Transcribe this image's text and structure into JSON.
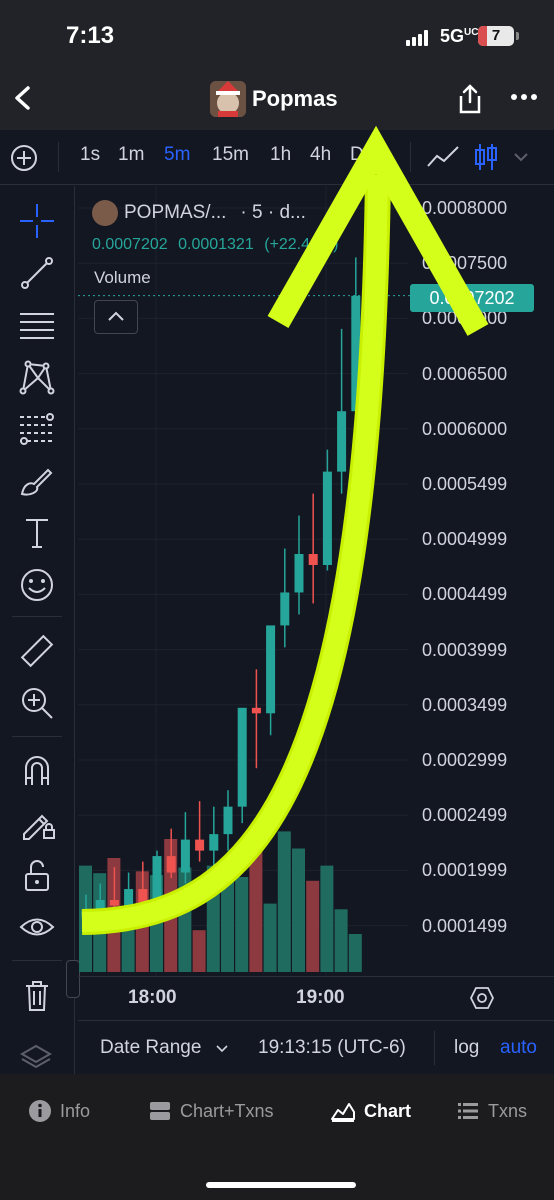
{
  "status_bar": {
    "time": "7:13",
    "network": "5G",
    "network_sup": "UC",
    "battery": "7"
  },
  "nav": {
    "title": "Popmas"
  },
  "toolbar": {
    "intervals": [
      {
        "label": "1s",
        "active": false
      },
      {
        "label": "1m",
        "active": false
      },
      {
        "label": "5m",
        "active": true
      },
      {
        "label": "15m",
        "active": false
      },
      {
        "label": "1h",
        "active": false
      },
      {
        "label": "4h",
        "active": false
      },
      {
        "label": "D",
        "active": false
      }
    ]
  },
  "left_tools": [
    "crosshair-icon",
    "trend-line-icon",
    "horizontal-lines-icon",
    "pattern-icon",
    "fib-icon",
    "brush-icon",
    "text-icon",
    "emoji-icon",
    "ruler-icon",
    "zoom-in-icon",
    "magnet-icon",
    "lock-drawing-icon",
    "unlock-icon",
    "eye-icon",
    "trash-icon",
    "layers-icon"
  ],
  "legend": {
    "symbol": "POPMAS/...",
    "interval": "· 5 · d...",
    "price": "0.0007202",
    "change": "0.0001321",
    "change_pct": "(+22.46%)",
    "volume_label": "Volume"
  },
  "price_axis": [
    "0.0008000",
    "0.0007500",
    "0.0007000",
    "0.0006500",
    "0.0006000",
    "0.0005499",
    "0.0004999",
    "0.0004499",
    "0.0003999",
    "0.0003499",
    "0.0002999",
    "0.0002499",
    "0.0001999",
    "0.0001499"
  ],
  "last_price": "0.0007202",
  "time_axis": [
    "18:00",
    "19:00"
  ],
  "bottom_bar": {
    "date_range": "Date Range",
    "clock": "19:13:15 (UTC-6)",
    "log": "log",
    "auto": "auto"
  },
  "tabs": [
    {
      "label": "Info",
      "active": false
    },
    {
      "label": "Chart+Txns",
      "active": false
    },
    {
      "label": "Chart",
      "active": true
    },
    {
      "label": "Txns",
      "active": false
    }
  ],
  "colors": {
    "up": "#26a69a",
    "down": "#ef5350",
    "accent": "#2962ff",
    "arrow": "#d4ff1a"
  },
  "chart_data": {
    "type": "candlestick",
    "interval": "5m",
    "price_axis_range": [
      0.00012,
      0.00081
    ],
    "candles": [
      {
        "o": 0.000155,
        "h": 0.000175,
        "l": 0.000142,
        "c": 0.00016
      },
      {
        "o": 0.00016,
        "h": 0.000185,
        "l": 0.00015,
        "c": 0.00017
      },
      {
        "o": 0.00017,
        "h": 0.0002,
        "l": 0.000155,
        "c": 0.000165
      },
      {
        "o": 0.000165,
        "h": 0.000195,
        "l": 0.00015,
        "c": 0.00018
      },
      {
        "o": 0.00018,
        "h": 0.000205,
        "l": 0.00017,
        "c": 0.000168
      },
      {
        "o": 0.000168,
        "h": 0.000215,
        "l": 0.00016,
        "c": 0.00021
      },
      {
        "o": 0.00021,
        "h": 0.000235,
        "l": 0.00019,
        "c": 0.000195
      },
      {
        "o": 0.000195,
        "h": 0.00025,
        "l": 0.000185,
        "c": 0.000225
      },
      {
        "o": 0.000225,
        "h": 0.00026,
        "l": 0.000205,
        "c": 0.000215
      },
      {
        "o": 0.000215,
        "h": 0.000255,
        "l": 0.0002,
        "c": 0.00023
      },
      {
        "o": 0.00023,
        "h": 0.00027,
        "l": 0.000215,
        "c": 0.000255
      },
      {
        "o": 0.000255,
        "h": 0.00032,
        "l": 0.00024,
        "c": 0.000345
      },
      {
        "o": 0.000345,
        "h": 0.00038,
        "l": 0.00029,
        "c": 0.00034
      },
      {
        "o": 0.00034,
        "h": 0.00041,
        "l": 0.00032,
        "c": 0.00042
      },
      {
        "o": 0.00042,
        "h": 0.00049,
        "l": 0.0004,
        "c": 0.00045
      },
      {
        "o": 0.00045,
        "h": 0.00052,
        "l": 0.00043,
        "c": 0.000485
      },
      {
        "o": 0.000485,
        "h": 0.00054,
        "l": 0.00044,
        "c": 0.000475
      },
      {
        "o": 0.000475,
        "h": 0.00058,
        "l": 0.00047,
        "c": 0.00056
      },
      {
        "o": 0.00056,
        "h": 0.00069,
        "l": 0.00054,
        "c": 0.000615
      },
      {
        "o": 0.000615,
        "h": 0.000755,
        "l": 0.0006,
        "c": 0.00072
      }
    ],
    "volume_relative": [
      0.56,
      0.52,
      0.6,
      0.33,
      0.53,
      0.51,
      0.7,
      0.55,
      0.22,
      0.56,
      0.59,
      0.5,
      0.68,
      0.36,
      0.74,
      0.65,
      0.48,
      0.56,
      0.33,
      0.2
    ]
  }
}
